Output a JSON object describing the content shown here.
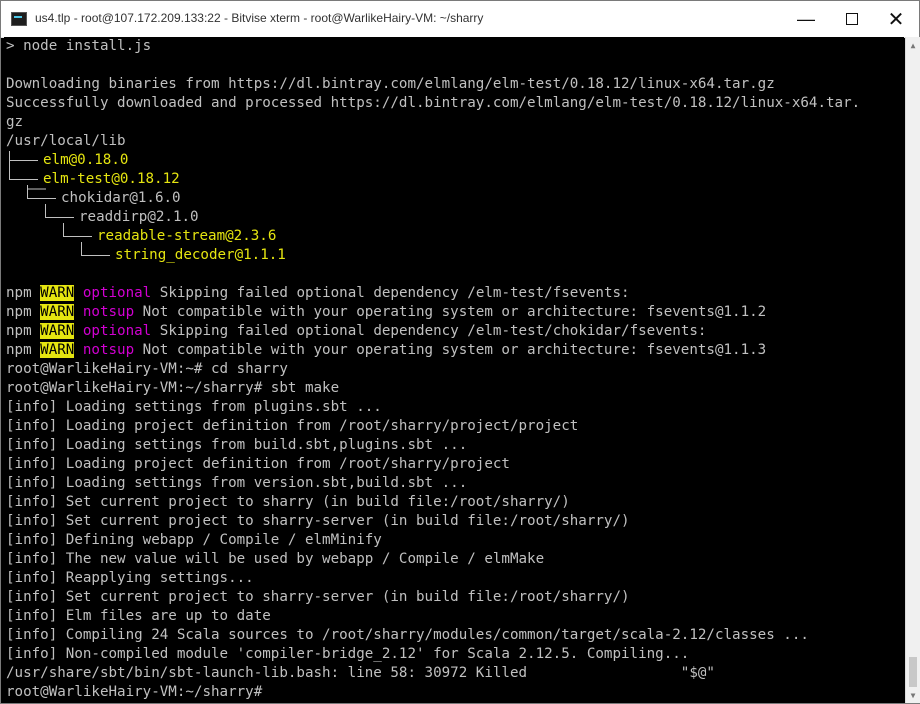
{
  "window": {
    "title": "us4.tlp - root@107.172.209.133:22 - Bitvise xterm - root@WarlikeHairy-VM: ~/sharry",
    "min_glyph": "—",
    "close_glyph": "✕"
  },
  "terminal": {
    "l1": "> node install.js",
    "l2": "",
    "l3": "Downloading binaries from https://dl.bintray.com/elmlang/elm-test/0.18.12/linux-x64.tar.gz",
    "l4": "Successfully downloaded and processed https://dl.bintray.com/elmlang/elm-test/0.18.12/linux-x64.tar.",
    "l5": "gz",
    "l6": "/usr/local/lib",
    "tree1": "elm@0.18.0",
    "tree2": "elm-test@0.18.12",
    "tree3": "chokidar@1.6.0",
    "tree4": "readdirp@2.1.0",
    "tree5": "readable-stream@2.3.6",
    "tree6": "string_decoder@1.1.1",
    "npm_prefix": "npm ",
    "warn": "WARN",
    "optional": "optional",
    "notsup": "notsup",
    "w1_rest": " Skipping failed optional dependency /elm-test/fsevents:",
    "w2_rest": " Not compatible with your operating system or architecture: fsevents@1.1.2",
    "w3_rest": " Skipping failed optional dependency /elm-test/chokidar/fsevents:",
    "w4_rest": " Not compatible with your operating system or architecture: fsevents@1.1.3",
    "p1": "root@WarlikeHairy-VM:~# cd sharry",
    "p2": "root@WarlikeHairy-VM:~/sharry# sbt make",
    "i1": "[info] Loading settings from plugins.sbt ...",
    "i2": "[info] Loading project definition from /root/sharry/project/project",
    "i3": "[info] Loading settings from build.sbt,plugins.sbt ...",
    "i4": "[info] Loading project definition from /root/sharry/project",
    "i5": "[info] Loading settings from version.sbt,build.sbt ...",
    "i6": "[info] Set current project to sharry (in build file:/root/sharry/)",
    "i7": "[info] Set current project to sharry-server (in build file:/root/sharry/)",
    "i8": "[info] Defining webapp / Compile / elmMinify",
    "i9": "[info] The new value will be used by webapp / Compile / elmMake",
    "i10": "[info] Reapplying settings...",
    "i11": "[info] Set current project to sharry-server (in build file:/root/sharry/)",
    "i12": "[info] Elm files are up to date",
    "i13": "[info] Compiling 24 Scala sources to /root/sharry/modules/common/target/scala-2.12/classes ...",
    "i14": "[info] Non-compiled module 'compiler-bridge_2.12' for Scala 2.12.5. Compiling...",
    "k1": "/usr/share/sbt/bin/sbt-launch-lib.bash: line 58: 30972 Killed                  \"$@\"",
    "p3": "root@WarlikeHairy-VM:~/sharry# "
  },
  "colors": {
    "background": "#000000",
    "text": "#c0c0c0",
    "yellow": "#e5e510",
    "magenta": "#d200d2"
  }
}
